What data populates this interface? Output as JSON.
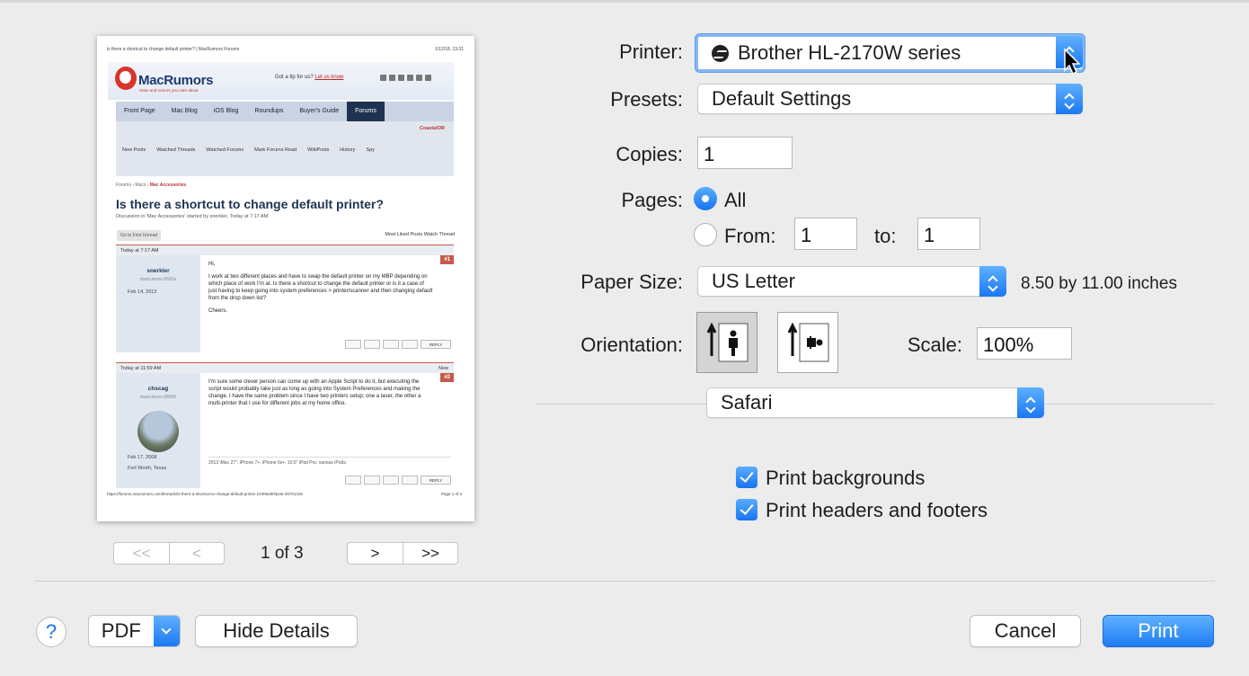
{
  "preview": {
    "header_left": "is there a shortcut to change default printer? | MacRumors Forums",
    "header_right": "1/12/18, 13:31",
    "logo_text": "MacRumors",
    "logo_tagline": "news and rumors you care about",
    "tip_text": "Got a tip for us?",
    "tip_link": "Let us know",
    "nav": [
      "Front Page",
      "Mac Blog",
      "iOS Blog",
      "Roundups",
      "Buyer's Guide",
      "Forums"
    ],
    "user_badge": "CoastalOR",
    "subnav": [
      "New Posts",
      "Watched Threads",
      "Watched Forums",
      "Mark Forums Read",
      "WikiPosts",
      "History",
      "Spy"
    ],
    "breadcrumb_forums": "Forums",
    "breadcrumb_macs": "Macs",
    "breadcrumb_current": "Mac Accessories",
    "thread_title": "Is there a shortcut to change default printer?",
    "discussion": "Discussion in 'Mac Accessories' started by snerkler, Today at 7:17 AM.",
    "go_first_unread": "Go to First Unread",
    "most_liked": "Most Liked Posts  Watch Thread",
    "post1": {
      "time": "Today at 7:17 AM",
      "number": "#1",
      "username": "snerkler",
      "rank": "macrumors 6502a",
      "joined": "Feb 14, 2012",
      "greeting": "Hi,",
      "body": "I work at two different places and have to swap the default printer on my MBP depending on which place of work I'm at. Is there a shortcut to change the default printer or is it a case of just having to keep going into system preferences > printer/scanner and then changing default from the drop down list?",
      "signoff": "Cheers.",
      "reply": "REPLY"
    },
    "post2": {
      "time": "Today at 11:59 AM",
      "new": "New",
      "number": "#2",
      "username": "chscag",
      "rank": "macrumors 68000",
      "joined": "Feb 17, 2008",
      "location": "Fort Worth, Texas",
      "body": "I'm sure some clever person can come up with an Apple Script to do it, but executing the script would probably take just as long as going into System Preferences and making the change. I have the same problem since I have two printers setup; one a laser, the other a multi-printer that I use for different jobs at my home office.",
      "signature": "2013 iMac 27\", iPhone 7+, iPhone 6s+, 10.5\" iPad Pro, various iPods.",
      "reply": "REPLY"
    },
    "footer_left": "https://forums.macrumors.com/threads/is-there-a-shortcut-to-change-default-printer.2100628/#post-25701416",
    "footer_right": "Page 1 of 3"
  },
  "pager": {
    "first": "<<",
    "prev": "<",
    "label": "1 of 3",
    "next": ">",
    "last": ">>"
  },
  "form": {
    "printer_label": "Printer:",
    "printer_value": "Brother HL-2170W series",
    "presets_label": "Presets:",
    "presets_value": "Default Settings",
    "copies_label": "Copies:",
    "copies_value": "1",
    "pages_label": "Pages:",
    "pages_all": "All",
    "pages_from": "From:",
    "pages_from_value": "1",
    "pages_to": "to:",
    "pages_to_value": "1",
    "pages_selected": "All",
    "paper_label": "Paper Size:",
    "paper_value": "US Letter",
    "paper_dims": "8.50 by 11.00 inches",
    "orientation_label": "Orientation:",
    "orientation_selected": "portrait",
    "scale_label": "Scale:",
    "scale_value": "100%",
    "section_value": "Safari",
    "print_backgrounds": "Print backgrounds",
    "print_backgrounds_checked": true,
    "print_headers": "Print headers and footers",
    "print_headers_checked": true
  },
  "footer": {
    "help": "?",
    "pdf": "PDF",
    "hide_details": "Hide Details",
    "cancel": "Cancel",
    "print": "Print"
  },
  "colors": {
    "accent": "#1b78f2",
    "background": "#ececec"
  }
}
